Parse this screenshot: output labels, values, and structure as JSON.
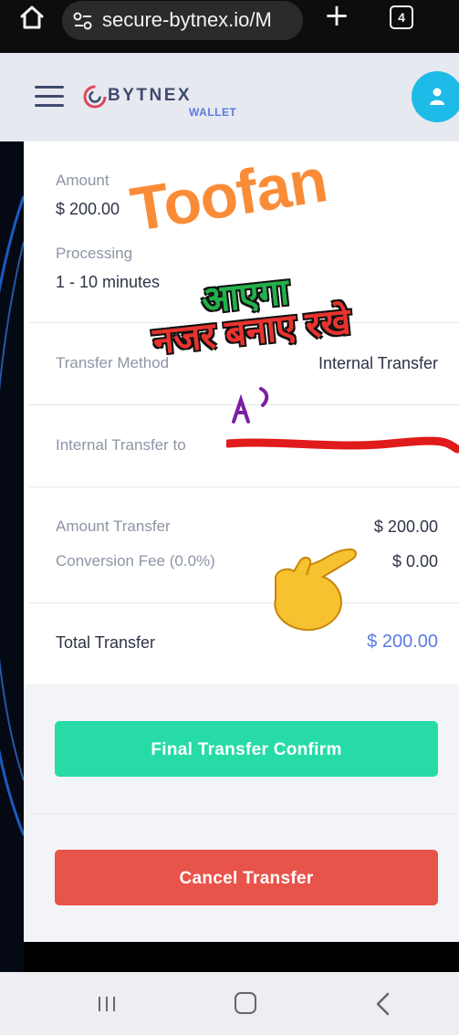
{
  "browser": {
    "url": "secure-bytnex.io/M",
    "tab_count": "4",
    "plus_symbol": "+"
  },
  "header": {
    "logo_text": "BYTNEX",
    "logo_sub": "WALLET"
  },
  "details": {
    "amount_label": "Amount",
    "amount_value": "$ 200.00",
    "processing_label": "Processing",
    "processing_value": "1 - 10 minutes",
    "method_label": "Transfer Method",
    "method_value": "Internal Transfer",
    "transfer_to_label": "Internal Transfer to"
  },
  "summary": {
    "amount_transfer_label": "Amount Transfer",
    "amount_transfer_value": "$ 200.00",
    "fee_label": "Conversion Fee (0.0%)",
    "fee_value": "$ 0.00",
    "total_label": "Total Transfer",
    "total_value": "$ 200.00"
  },
  "actions": {
    "confirm_label": "Final Transfer Confirm",
    "cancel_label": "Cancel Transfer"
  },
  "overlays": {
    "title_text": "Toofan",
    "hindi_line1": "आएगा",
    "hindi_line2": "नजर बनाए रखे"
  },
  "colors": {
    "confirm": "#27dba6",
    "cancel": "#e8534a",
    "total_accent": "#5a7be0",
    "avatar": "#1ebbe8"
  }
}
